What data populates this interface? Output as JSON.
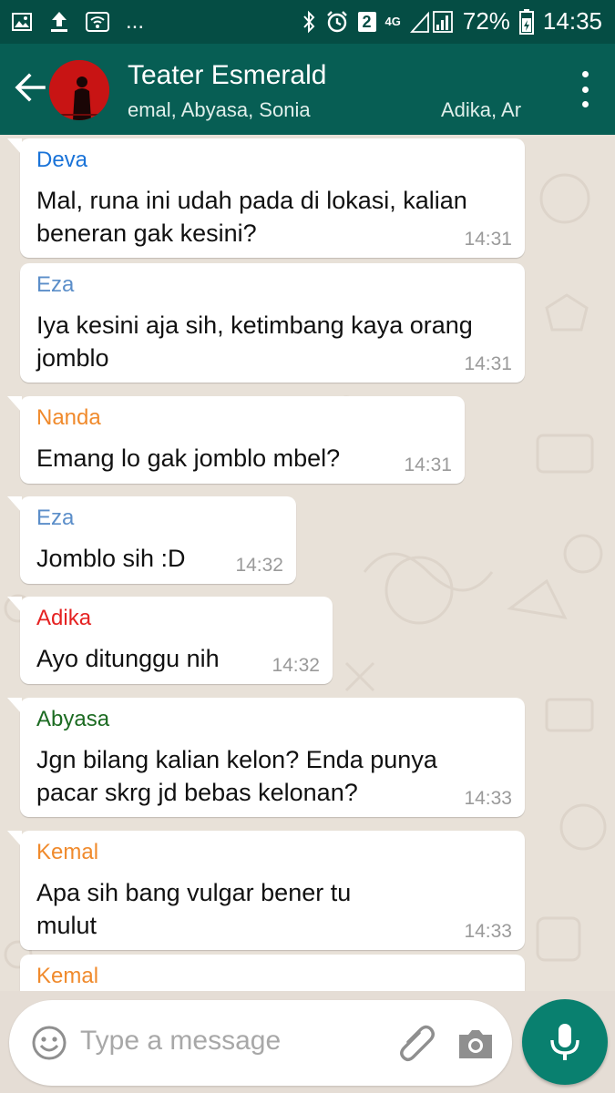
{
  "status_bar": {
    "battery": "72%",
    "time": "14:35",
    "notif_badge": "2",
    "network": "4G",
    "more": "..."
  },
  "header": {
    "title": "Teater Esmerald",
    "subtitle_left": "emal, Abyasa, Sonia",
    "subtitle_right": "Adika, Ar"
  },
  "messages": [
    {
      "sender": "Deva",
      "sender_color": "#1a73d8",
      "lines": [
        "Mal, runa ini udah pada di lokasi, kalian",
        "beneran gak kesini?"
      ],
      "time": "14:31"
    },
    {
      "sender": "Eza",
      "sender_color": "#5b8ec9",
      "lines": [
        "Iya kesini aja sih, ketimbang kaya orang",
        "jomblo"
      ],
      "time": "14:31"
    },
    {
      "sender": "Nanda",
      "sender_color": "#f08a2c",
      "lines": [
        "Emang lo gak jomblo mbel?"
      ],
      "time": "14:31"
    },
    {
      "sender": "Eza",
      "sender_color": "#5b8ec9",
      "lines": [
        "Jomblo sih :D"
      ],
      "time": "14:32"
    },
    {
      "sender": "Adika",
      "sender_color": "#e52222",
      "lines": [
        "Ayo ditunggu nih"
      ],
      "time": "14:32"
    },
    {
      "sender": "Abyasa",
      "sender_color": "#1c6b22",
      "lines": [
        "Jgn bilang kalian kelon? Enda punya",
        "pacar skrg jd bebas kelonan?"
      ],
      "time": "14:33"
    },
    {
      "sender": "Kemal",
      "sender_color": "#f08a2c",
      "lines": [
        "Apa sih bang vulgar bener tu",
        "mulut"
      ],
      "time": "14:33"
    },
    {
      "sender": "Kemal",
      "sender_color": "#f08a2c",
      "lines": [],
      "time": ""
    }
  ],
  "input": {
    "placeholder": "Type a message"
  },
  "colors": {
    "header": "#075e54",
    "status_bar": "#054d44",
    "mic_button": "#09806f"
  },
  "icons": [
    "image-icon",
    "upload-icon",
    "wifi-icon",
    "bluetooth-icon",
    "alarm-icon",
    "signal-icon",
    "battery-icon",
    "back-arrow-icon",
    "more-vert-icon",
    "emoji-icon",
    "attach-icon",
    "camera-icon",
    "mic-icon"
  ]
}
